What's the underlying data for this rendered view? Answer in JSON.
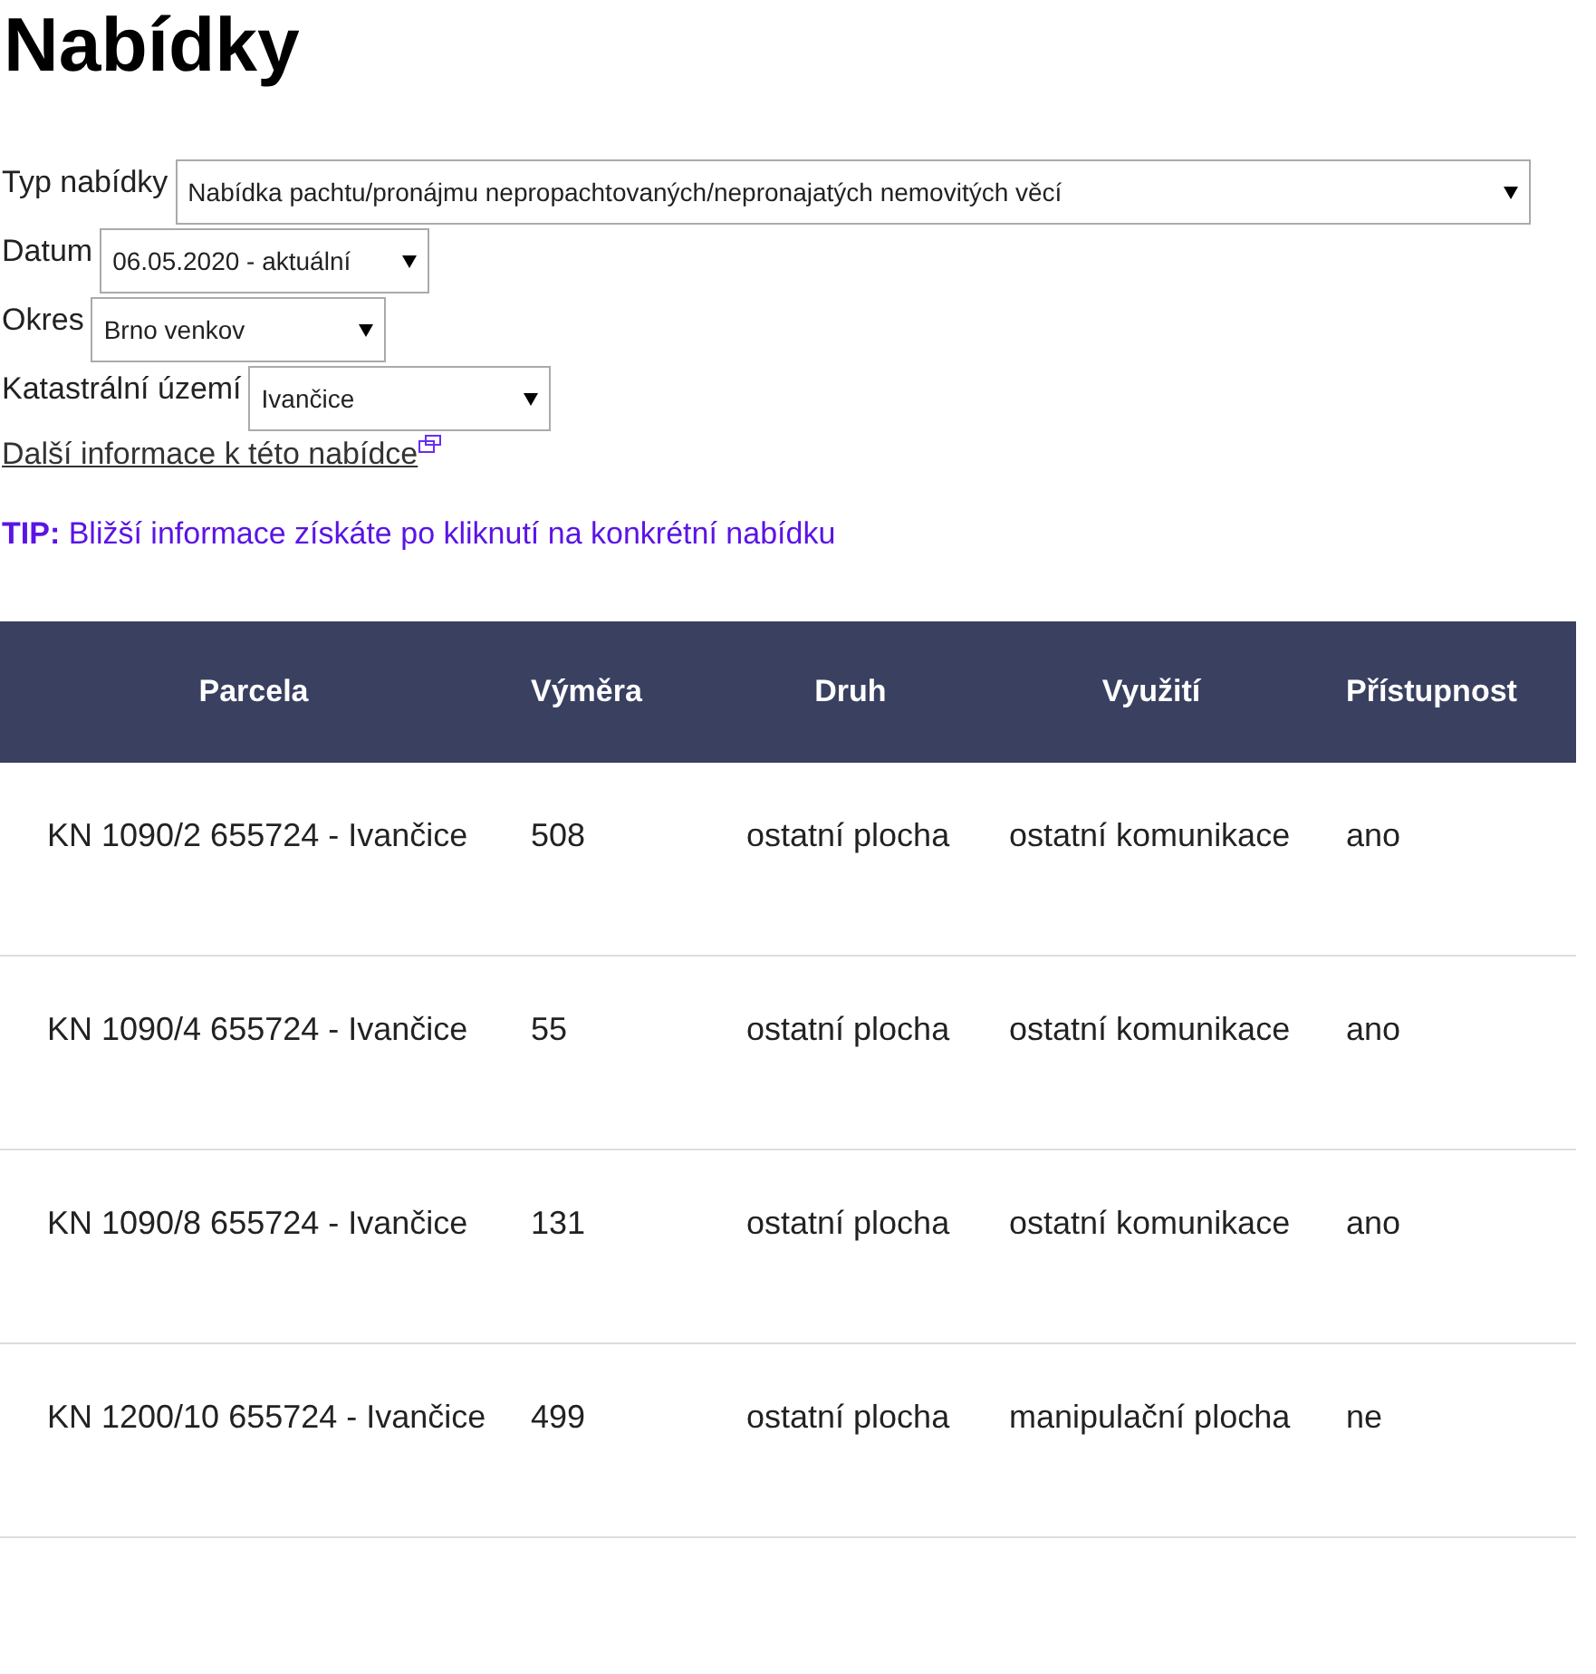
{
  "title": "Nabídky",
  "filters": [
    {
      "label": "Typ nabídky",
      "value": "Nabídka pachtu/pronájmu nepropachtovaných/nepronajatých nemovitých věcí"
    },
    {
      "label": "Datum",
      "value": "06.05.2020 - aktuální"
    },
    {
      "label": "Okres",
      "value": "Brno venkov"
    },
    {
      "label": "Katastrální území",
      "value": "Ivančice"
    }
  ],
  "info_link": "Další informace k této nabídce",
  "tip": "**TIP:** Bližší informace získáte po kliknutí na konkrétní nabídku",
  "table": {
    "columns": [
      "Parcela",
      "Výměra",
      "Druh",
      "Využití",
      "Přístupnost"
    ],
    "rows": [
      [
        "KN 1090/2 655724 - Ivančice",
        "508",
        "ostatní plocha",
        "ostatní komunikace",
        "ano"
      ],
      [
        "KN 1090/4 655724 - Ivančice",
        "55",
        "ostatní plocha",
        "ostatní komunikace",
        "ano"
      ],
      [
        "KN 1090/8 655724 - Ivančice",
        "131",
        "ostatní plocha",
        "ostatní komunikace",
        "ano"
      ],
      [
        "KN 1200/10 655724 - Ivančice",
        "499",
        "ostatní plocha",
        "manipulační plocha",
        "ne"
      ]
    ]
  }
}
